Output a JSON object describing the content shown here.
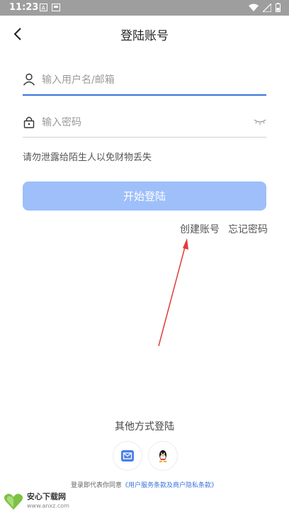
{
  "status_bar": {
    "time": "11:23"
  },
  "header": {
    "title": "登陆账号"
  },
  "form": {
    "username_placeholder": "输入用户名/邮箱",
    "password_placeholder": "输入密码",
    "warning": "请勿泄露给陌生人以免财物丢失",
    "login_label": "开始登陆"
  },
  "links": {
    "create_account": "创建账号",
    "forgot_password": "忘记密码"
  },
  "other_login": {
    "title": "其他方式登陆",
    "methods": [
      "mail-icon",
      "qq-icon"
    ]
  },
  "terms": {
    "prefix": "登录即代表你同意",
    "link": "《用户服务条款及商户隐私条款》"
  },
  "watermark": {
    "brand": "安心下载网",
    "url": "www.anxz.com"
  },
  "colors": {
    "primary": "#3a74d9",
    "button": "#9ebffa",
    "annotation": "#e23b3b"
  }
}
